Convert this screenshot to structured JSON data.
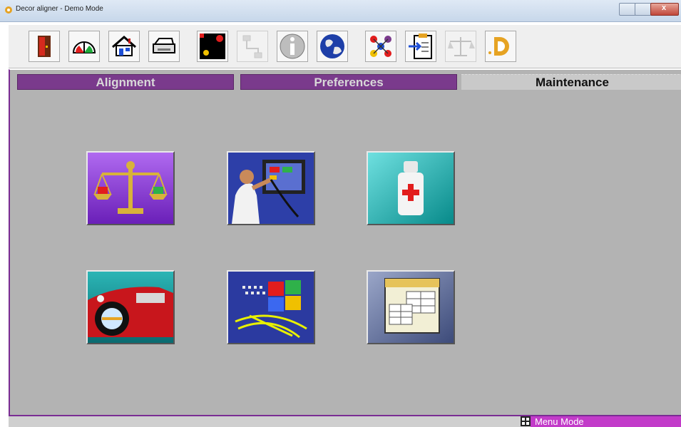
{
  "window": {
    "title": "Decor aligner - Demo Mode"
  },
  "window_controls": {
    "close_symbol": "x"
  },
  "toolbar": {
    "buttons": [
      {
        "name": "exit-door-icon",
        "enabled": true
      },
      {
        "name": "gauge-icon",
        "enabled": true
      },
      {
        "name": "home-icon",
        "enabled": true
      },
      {
        "name": "printer-icon",
        "enabled": true
      },
      {
        "name": "screen-display-icon",
        "enabled": true
      },
      {
        "name": "network-connection-icon",
        "enabled": false
      },
      {
        "name": "info-icon",
        "enabled": true
      },
      {
        "name": "globe-icon",
        "enabled": true
      },
      {
        "name": "molecule-icon",
        "enabled": true
      },
      {
        "name": "clipboard-import-icon",
        "enabled": true
      },
      {
        "name": "mks-scale-icon",
        "enabled": false
      },
      {
        "name": "d-logo-icon",
        "enabled": true
      }
    ]
  },
  "tabs": [
    {
      "label": "Alignment",
      "active": false
    },
    {
      "label": "Preferences",
      "active": false
    },
    {
      "label": "Maintenance",
      "active": true
    }
  ],
  "maintenance": {
    "tiles": [
      {
        "name": "calibration-scale-icon"
      },
      {
        "name": "diagnostics-technician-icon"
      },
      {
        "name": "first-aid-bottle-icon"
      },
      {
        "name": "vintage-car-icon"
      },
      {
        "name": "windows-tools-icon"
      },
      {
        "name": "data-tables-icon"
      }
    ]
  },
  "statusbar": {
    "mode": "Menu Mode"
  },
  "colors": {
    "accent": "#7a3a8c",
    "status_bg": "#c23bc9",
    "panel_bg": "#b3b3b3"
  }
}
